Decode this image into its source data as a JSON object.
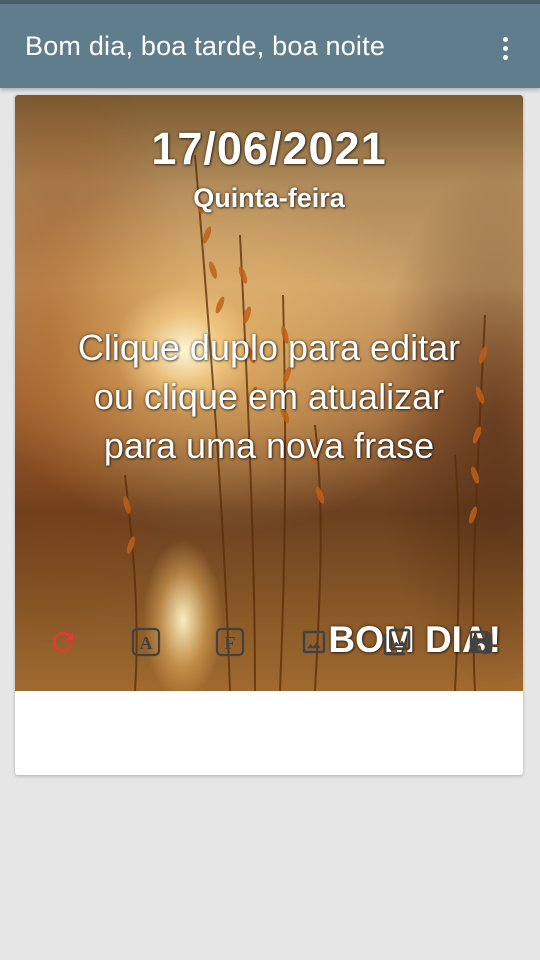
{
  "appbar": {
    "title": "Bom dia, boa tarde, boa noite",
    "menu_icon": "more-vertical-icon"
  },
  "card": {
    "date": "17/06/2021",
    "weekday": "Quinta-feira",
    "phrase_lines": [
      "Clique duplo para editar",
      "ou clique em atualizar",
      "para uma nova frase"
    ],
    "greeting": "BOM DIA!"
  },
  "toolbar": {
    "items": [
      {
        "icon": "refresh-icon",
        "color": "#e53935"
      },
      {
        "icon": "text-font-a-icon",
        "color": "#424242"
      },
      {
        "icon": "text-font-f-icon",
        "color": "#424242"
      },
      {
        "icon": "image-icon",
        "color": "#424242"
      },
      {
        "icon": "image-library-icon",
        "color": "#424242"
      },
      {
        "icon": "save-icon",
        "color": "#424242"
      }
    ]
  },
  "colors": {
    "appbar": "#607d8b",
    "background": "#e6e6e6",
    "accent_red": "#e53935"
  }
}
